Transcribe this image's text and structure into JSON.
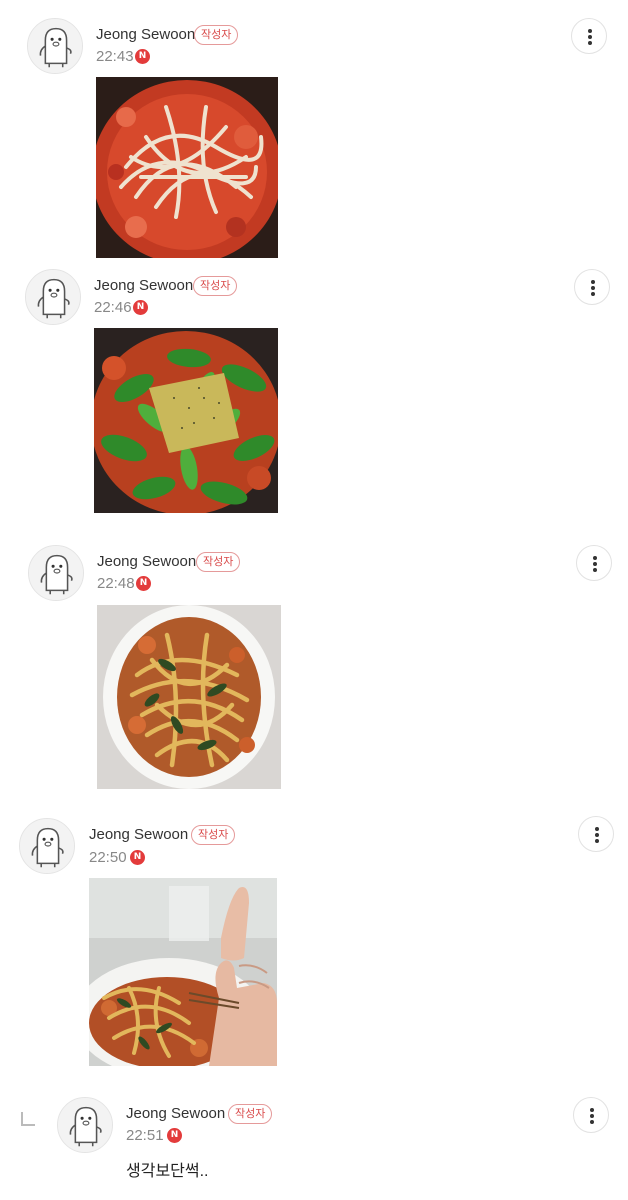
{
  "comments": [
    {
      "author": "Jeong Sewoon",
      "author_badge": "작성자",
      "time": "22:43",
      "new_label": "N",
      "photo": "tomato-sauce-with-raw-noodles"
    },
    {
      "author": "Jeong Sewoon",
      "author_badge": "작성자",
      "time": "22:46",
      "new_label": "N",
      "photo": "pan-with-greens-and-pepper"
    },
    {
      "author": "Jeong Sewoon",
      "author_badge": "작성자",
      "time": "22:48",
      "new_label": "N",
      "photo": "plated-noodles-with-spinach"
    },
    {
      "author": "Jeong Sewoon",
      "author_badge": "작성자",
      "time": "22:50",
      "new_label": "N",
      "photo": "noodles-with-thumbs-up"
    }
  ],
  "reply": {
    "author": "Jeong Sewoon",
    "author_badge": "작성자",
    "time": "22:51",
    "new_label": "N",
    "text": "생각보단썩.."
  },
  "colors": {
    "badge_border": "#e59a9a",
    "badge_text": "#d94b4b",
    "new_dot": "#e33b3b"
  }
}
